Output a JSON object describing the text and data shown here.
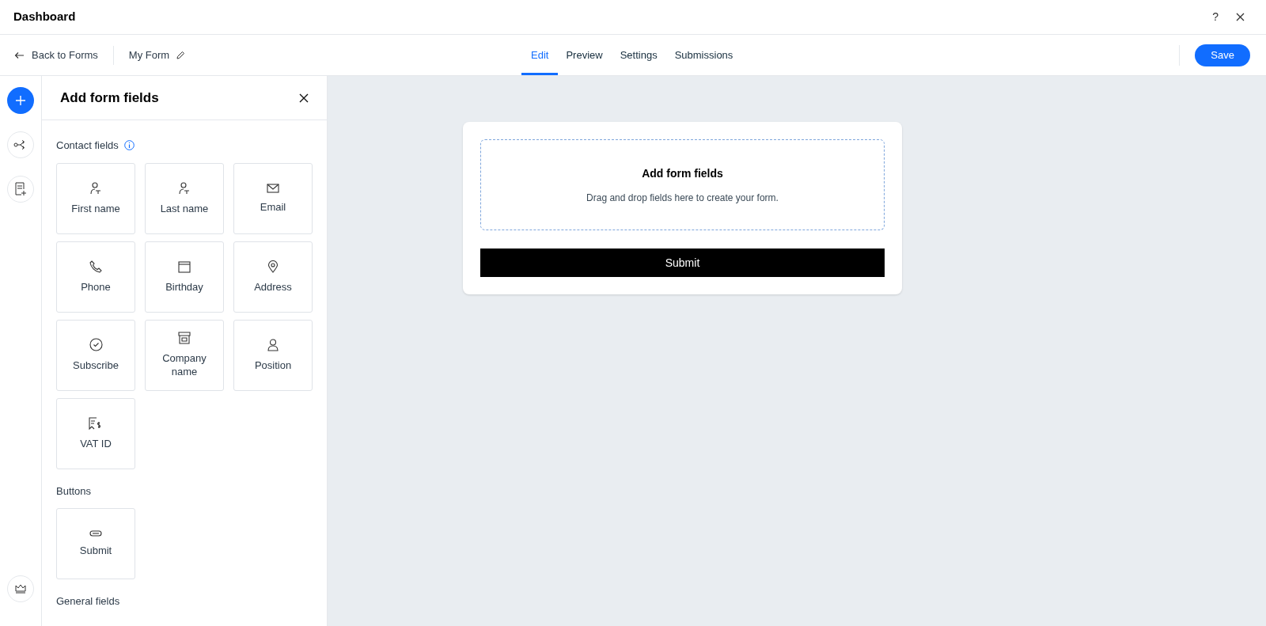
{
  "window": {
    "title": "Dashboard",
    "help": "?"
  },
  "toolbar": {
    "back": "Back to Forms",
    "form_name": "My Form",
    "save": "Save"
  },
  "tabs": [
    {
      "label": "Edit",
      "selected": true
    },
    {
      "label": "Preview",
      "selected": false
    },
    {
      "label": "Settings",
      "selected": false
    },
    {
      "label": "Submissions",
      "selected": false
    }
  ],
  "panel": {
    "title": "Add form fields",
    "sections": [
      {
        "title": "Contact fields",
        "info": true,
        "items": [
          "First name",
          "Last name",
          "Email",
          "Phone",
          "Birthday",
          "Address",
          "Subscribe",
          "Company name",
          "Position",
          "VAT ID"
        ]
      },
      {
        "title": "Buttons",
        "info": false,
        "items": [
          "Submit"
        ]
      },
      {
        "title": "General fields",
        "info": false
      }
    ]
  },
  "form": {
    "drop_title": "Add form fields",
    "drop_hint": "Drag and drop fields here to create your form.",
    "submit": "Submit"
  }
}
